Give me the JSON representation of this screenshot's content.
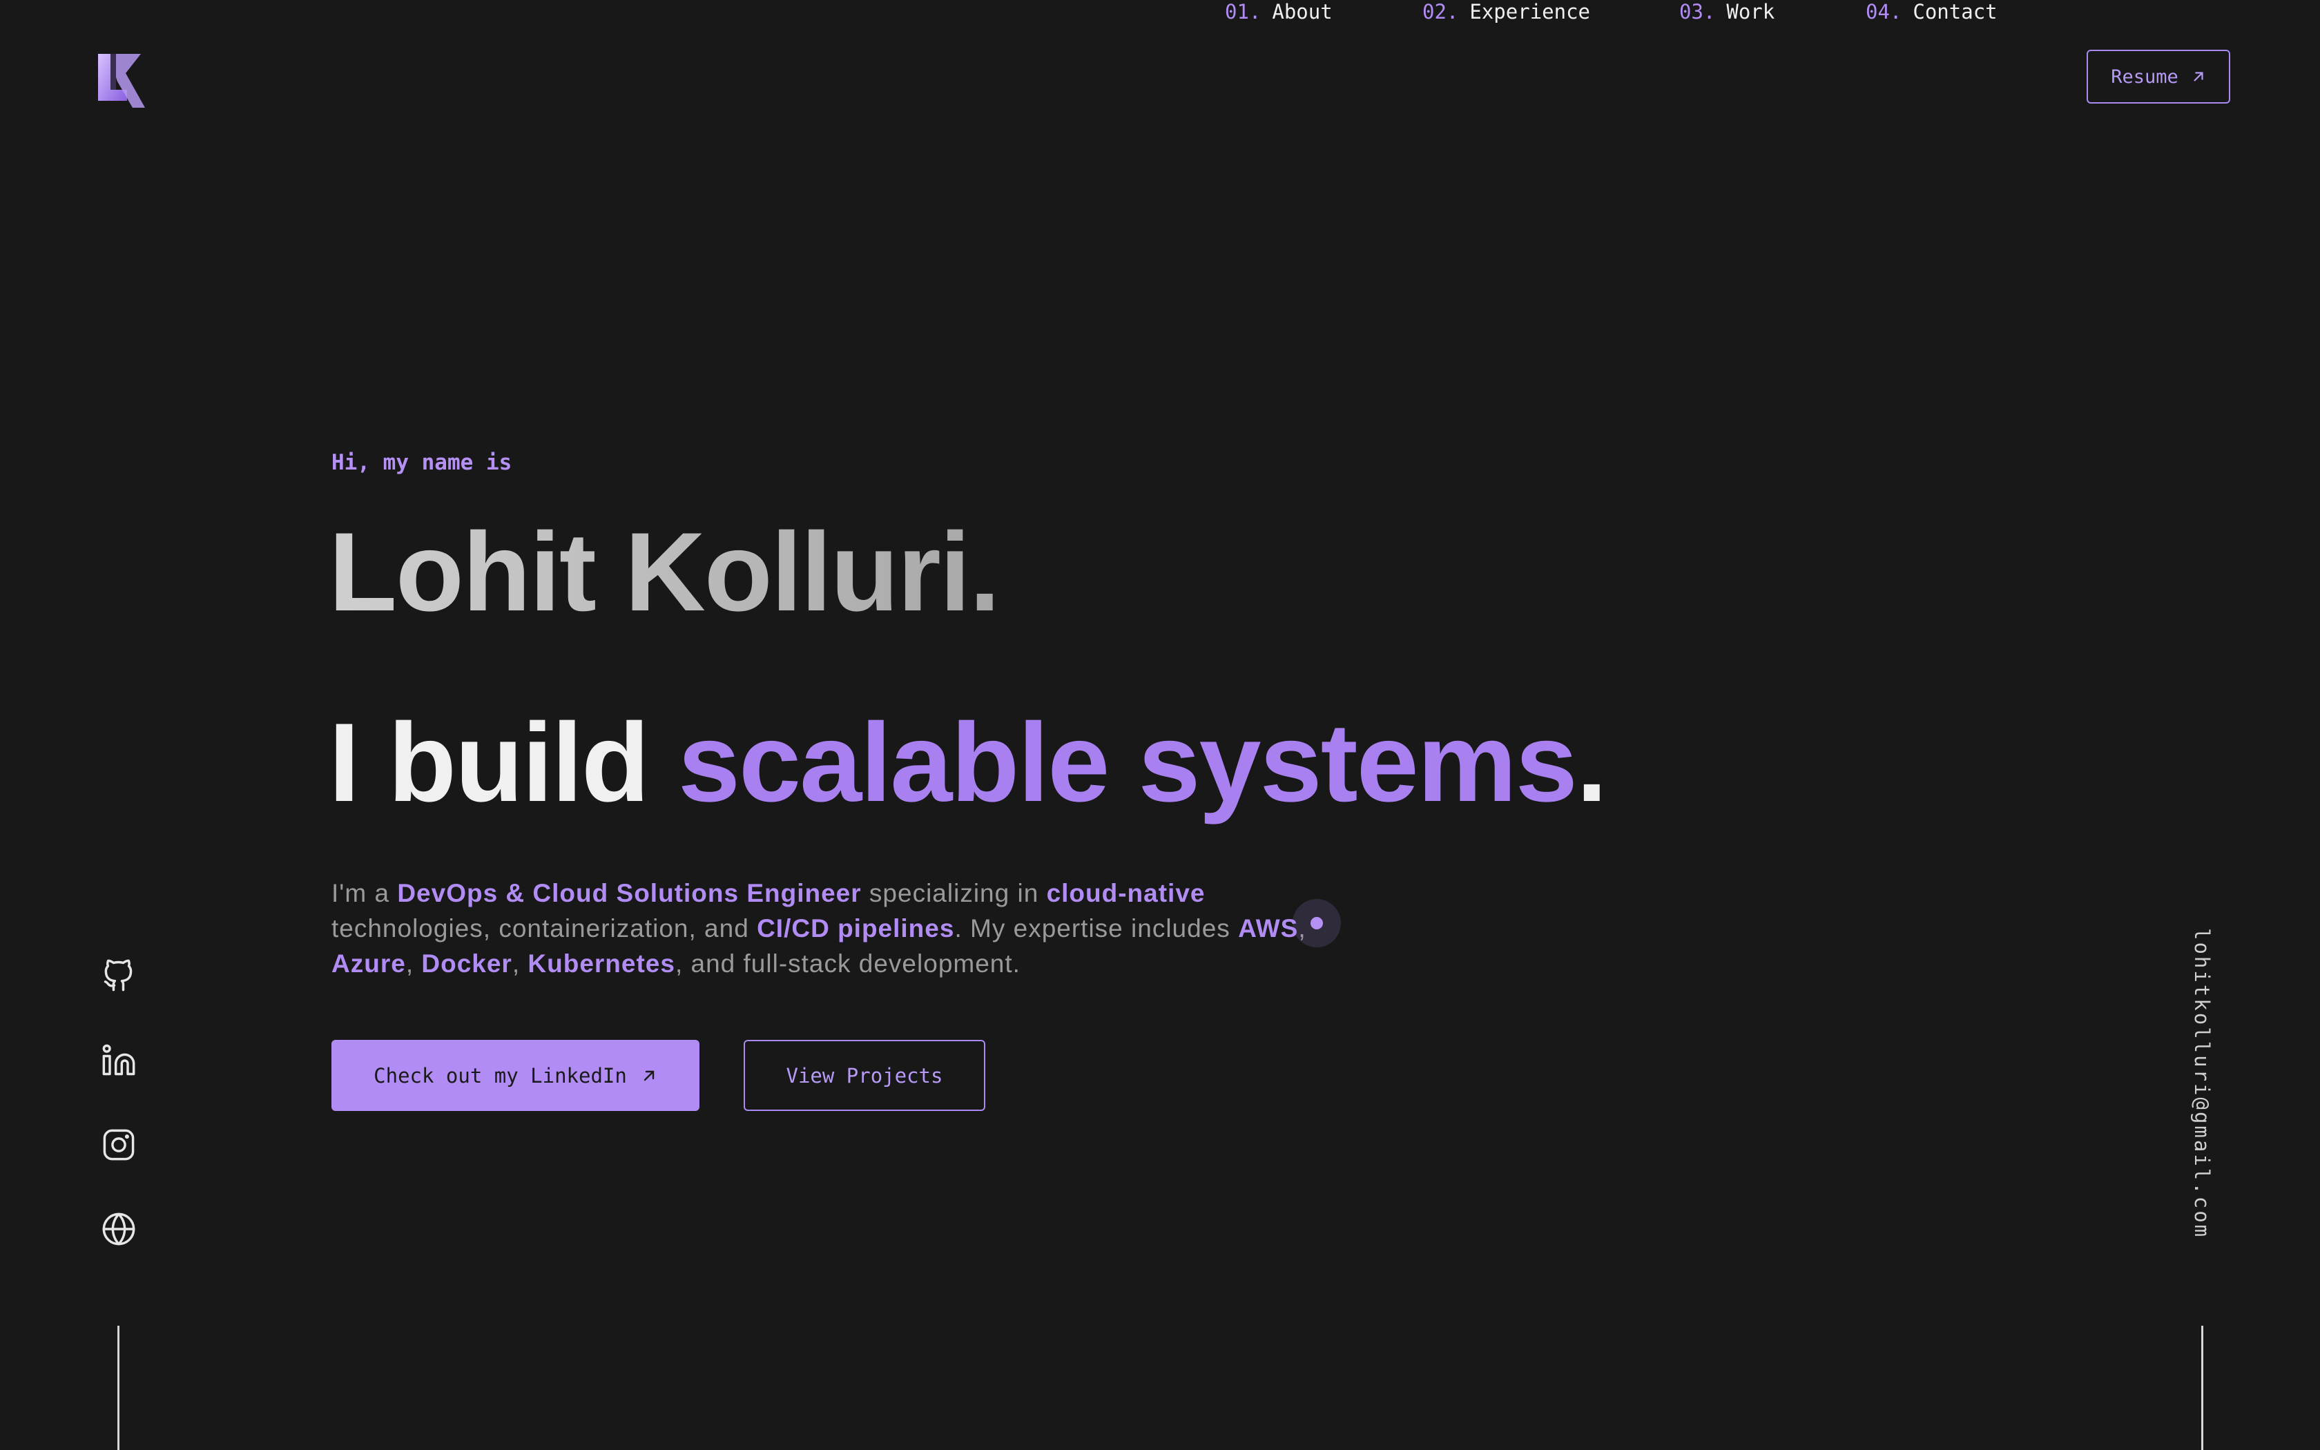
{
  "logo": {
    "alt": "LK"
  },
  "nav": {
    "items": [
      {
        "number": "01.",
        "label": "About"
      },
      {
        "number": "02.",
        "label": "Experience"
      },
      {
        "number": "03.",
        "label": "Work"
      },
      {
        "number": "04.",
        "label": "Contact"
      }
    ],
    "resume_label": "Resume"
  },
  "hero": {
    "greeting": "Hi, my name is",
    "name": "Lohit Kolluri.",
    "tagline_plain": "I build ",
    "tagline_highlight": "scalable systems",
    "tagline_end": ".",
    "bio": {
      "p1": "I'm a ",
      "h1": "DevOps & Cloud Solutions Engineer",
      "p2": " specializing in ",
      "h2": "cloud-native",
      "p3": " technologies, containerization, and ",
      "h3": "CI/CD pipelines",
      "p4": ". My expertise includes ",
      "h4": "AWS",
      "s1": ", ",
      "h5": "Azure",
      "s2": ", ",
      "h6": "Docker",
      "s3": ", ",
      "h7": "Kubernetes",
      "p5": ", and full-stack development."
    },
    "cta_primary": "Check out my LinkedIn",
    "cta_secondary": "View Projects"
  },
  "social": [
    "github-icon",
    "linkedin-icon",
    "instagram-icon",
    "globe-icon"
  ],
  "email": "lohitkolluri@gmail.com",
  "colors": {
    "background": "#181818",
    "accent": "#b08cf4",
    "text": "#f0f0f0",
    "muted": "#9a9a9a"
  }
}
